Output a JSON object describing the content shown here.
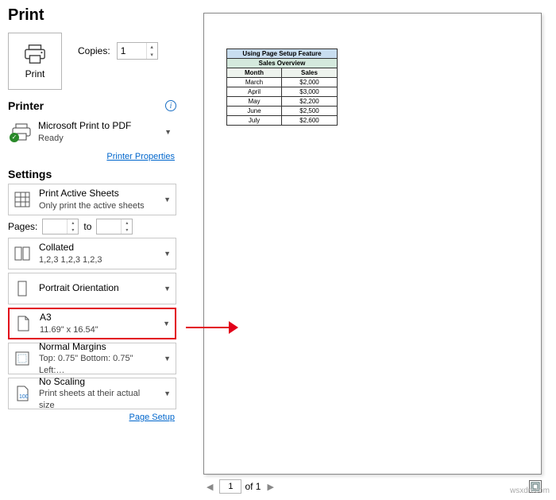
{
  "title": "Print",
  "print_button": "Print",
  "copies": {
    "label": "Copies:",
    "value": "1"
  },
  "printer": {
    "heading": "Printer",
    "name": "Microsoft Print to PDF",
    "status": "Ready",
    "properties_link": "Printer Properties"
  },
  "settings": {
    "heading": "Settings",
    "print_what": {
      "title": "Print Active Sheets",
      "sub": "Only print the active sheets"
    },
    "pages": {
      "label": "Pages:",
      "to": "to",
      "from": "",
      "until": ""
    },
    "collate": {
      "title": "Collated",
      "sub": "1,2,3    1,2,3    1,2,3"
    },
    "orientation": {
      "title": "Portrait Orientation"
    },
    "paper": {
      "title": "A3",
      "sub": "11.69\" x 16.54\""
    },
    "margins": {
      "title": "Normal Margins",
      "sub": "Top: 0.75\" Bottom: 0.75\" Left:…"
    },
    "scaling": {
      "title": "No Scaling",
      "sub": "Print sheets at their actual size",
      "badge": "100"
    },
    "page_setup_link": "Page Setup"
  },
  "preview": {
    "nav": {
      "current": "1",
      "of_label": "of 1"
    },
    "table": {
      "title1": "Using Page Setup Feature",
      "title2": "Sales Overview",
      "head": [
        "Month",
        "Sales"
      ],
      "rows": [
        [
          "March",
          "$2,000"
        ],
        [
          "April",
          "$3,000"
        ],
        [
          "May",
          "$2,200"
        ],
        [
          "June",
          "$2,500"
        ],
        [
          "July",
          "$2,600"
        ]
      ]
    }
  },
  "watermark": "wsxdn.com"
}
